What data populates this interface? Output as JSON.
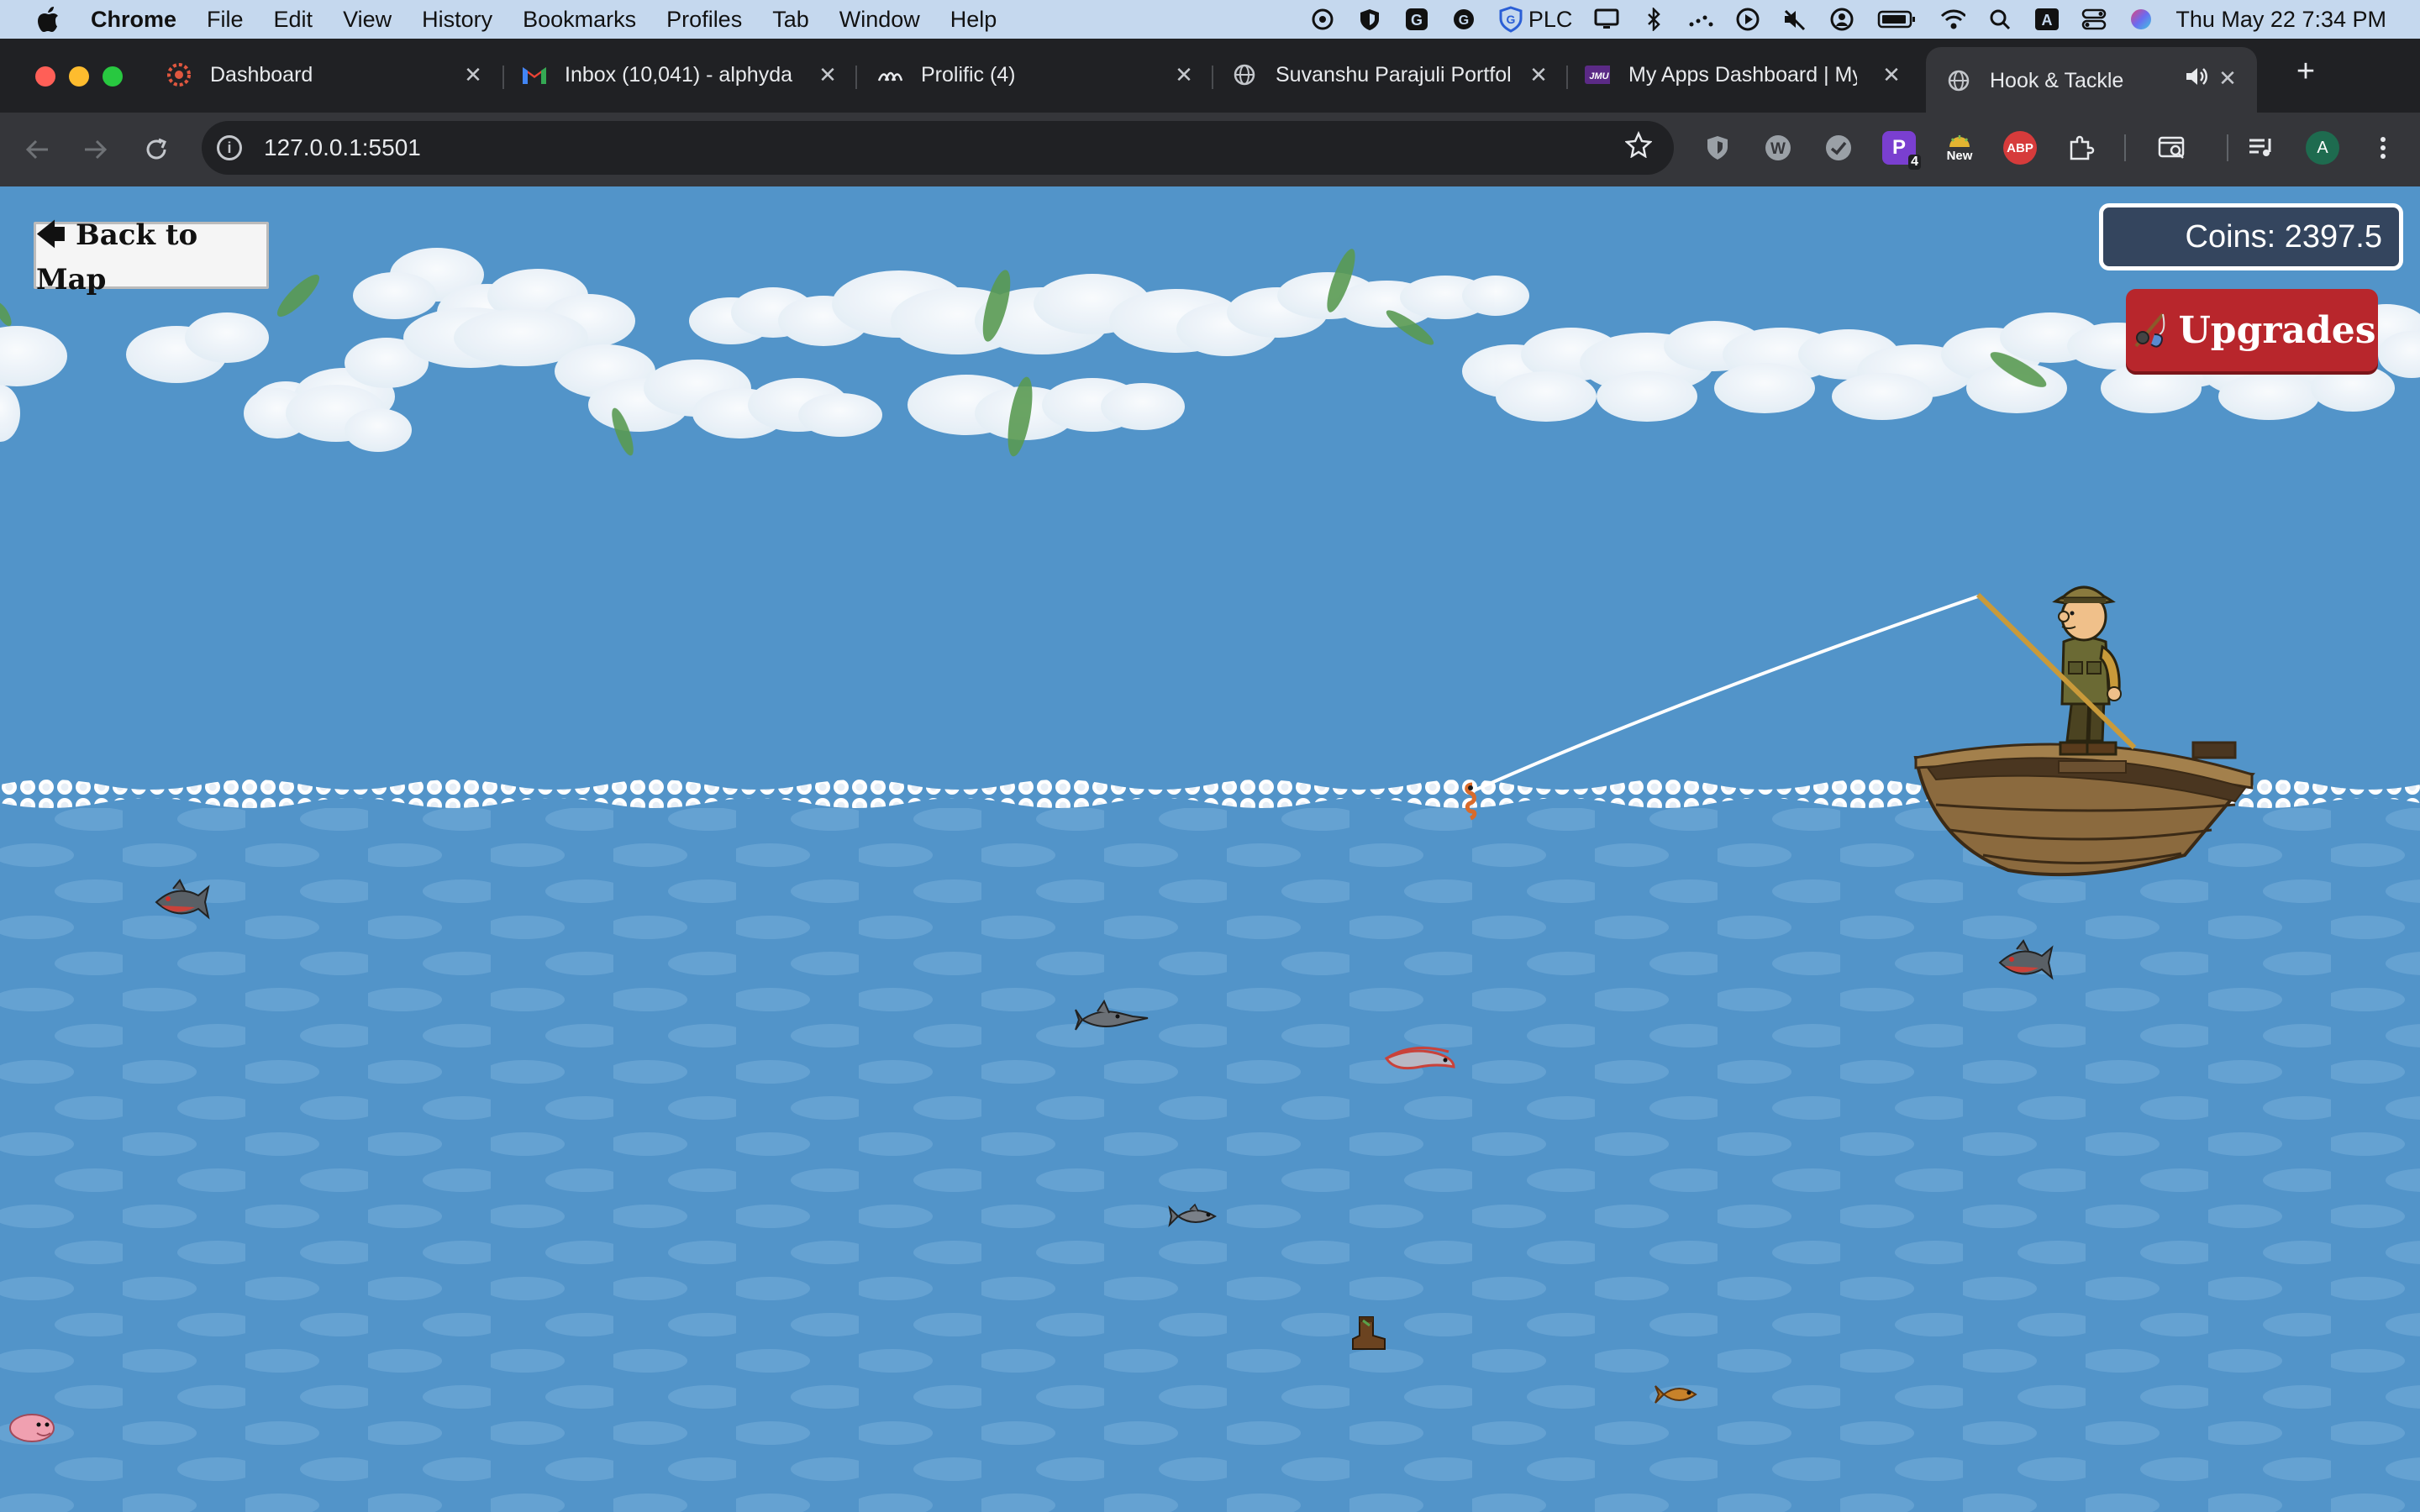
{
  "menubar": {
    "app": "Chrome",
    "items": [
      "File",
      "Edit",
      "View",
      "History",
      "Bookmarks",
      "Profiles",
      "Tab",
      "Window",
      "Help"
    ],
    "status_plc": "PLC",
    "clock": "Thu May 22  7:34 PM"
  },
  "tabs": [
    {
      "title": "Dashboard",
      "icon": "dashboard-icon",
      "active": false
    },
    {
      "title": "Inbox (10,041) - alphyda",
      "icon": "gmail-icon",
      "active": false
    },
    {
      "title": "Prolific (4)",
      "icon": "prolific-icon",
      "active": false
    },
    {
      "title": "Suvanshu Parajuli Portfol",
      "icon": "globe-icon",
      "active": false
    },
    {
      "title": "My Apps Dashboard | My",
      "icon": "jmu-icon",
      "active": false
    },
    {
      "title": "Hook & Tackle",
      "icon": "globe-icon",
      "active": true
    }
  ],
  "address": {
    "url": "127.0.0.1:5501"
  },
  "extensions": {
    "badge_p": "4",
    "badge_new": "New",
    "abp": "ABP",
    "profile": "A"
  },
  "game": {
    "back_label": "🡄 Back to Map",
    "coins_label": "Coins: 2397.5",
    "upgrades_label": "Upgrades"
  },
  "colors": {
    "sky": "#5294c9",
    "button_red": "#b8262c",
    "coins_bg": "#34455e"
  }
}
